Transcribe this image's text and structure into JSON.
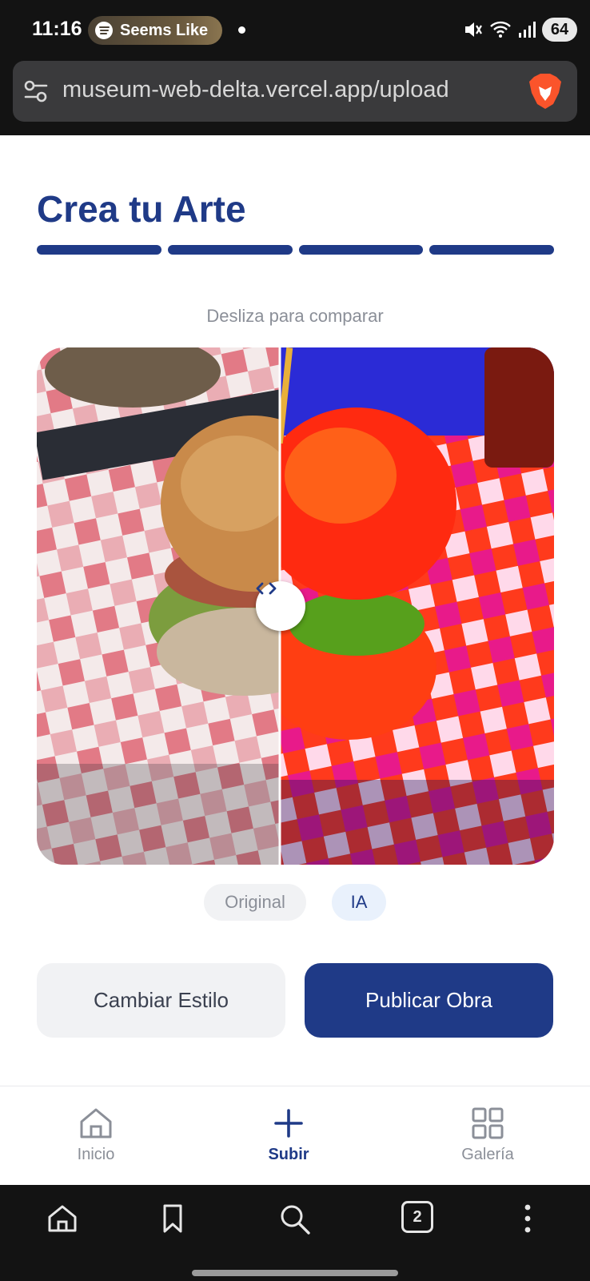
{
  "status_bar": {
    "time": "11:16",
    "media_text": "Seems Like",
    "battery": "64",
    "icons": [
      "mute-icon",
      "wifi-icon",
      "signal-icon"
    ]
  },
  "browser": {
    "url": "museum-web-delta.vercel.app/upload",
    "icons": [
      "tune-icon",
      "brave-lion-icon"
    ]
  },
  "page": {
    "title": "Crea tu Arte",
    "steps_total": 4,
    "steps_completed": 4,
    "compare_hint": "Desliza para comparar",
    "slider_position_fraction": 0.47,
    "labels": {
      "original": "Original",
      "ai": "IA"
    },
    "buttons": {
      "change_style": "Cambiar Estilo",
      "publish": "Publicar Obra"
    }
  },
  "app_nav": {
    "items": [
      {
        "label": "Inicio",
        "icon": "home-icon",
        "active": false
      },
      {
        "label": "Subir",
        "icon": "plus-icon",
        "active": true
      },
      {
        "label": "Galería",
        "icon": "grid-icon",
        "active": false
      }
    ]
  },
  "browser_nav": {
    "tabs_count": "2",
    "icons": [
      "home-icon",
      "bookmark-icon",
      "search-icon",
      "tabs-icon",
      "more-icon"
    ]
  },
  "colors": {
    "primary": "#1f3a87",
    "muted_text": "#8b8f98",
    "chip_bg": "#f1f2f4",
    "chip_active_bg": "#e9f1fc"
  }
}
